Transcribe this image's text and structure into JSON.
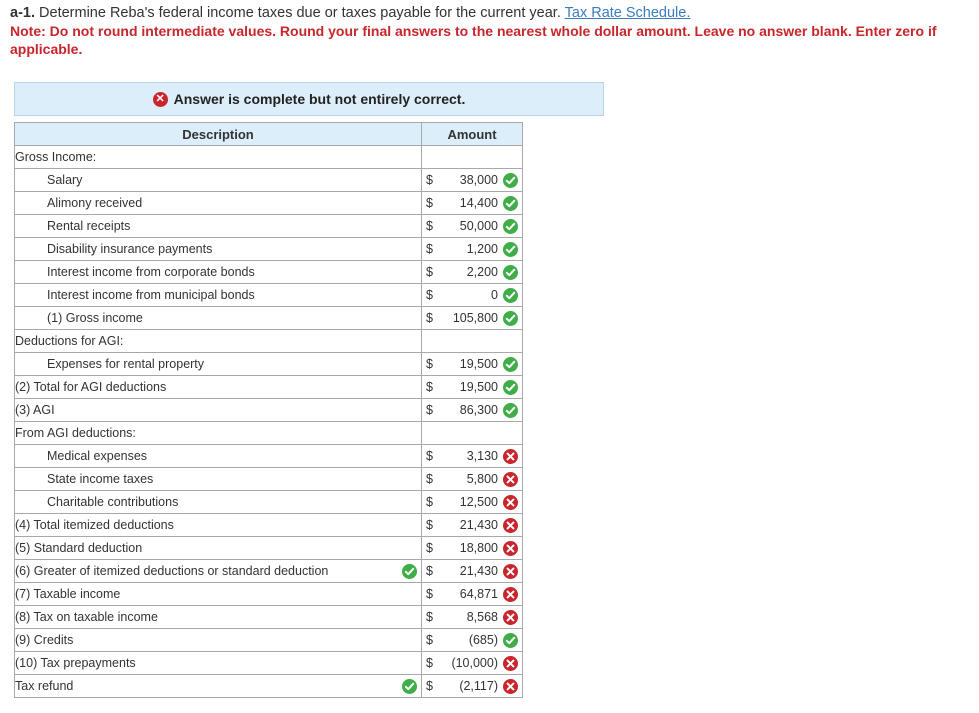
{
  "header": {
    "part": "a-1.",
    "question": " Determine Reba's federal income taxes due or taxes payable for the current year. ",
    "link": "Tax Rate Schedule.",
    "note": "Note: Do not round intermediate values. Round your final answers to the nearest whole dollar amount. Leave no answer blank. Enter zero if applicable."
  },
  "banner": {
    "text": "Answer is complete but not entirely correct."
  },
  "table": {
    "col_description": "Description",
    "col_amount": "Amount",
    "rows": [
      {
        "label": "Gross Income:",
        "indent": 0
      },
      {
        "label": "Salary",
        "indent": 1,
        "currency": "$",
        "amount": "38,000",
        "status": "correct"
      },
      {
        "label": "Alimony received",
        "indent": 1,
        "currency": "$",
        "amount": "14,400",
        "status": "correct"
      },
      {
        "label": "Rental receipts",
        "indent": 1,
        "currency": "$",
        "amount": "50,000",
        "status": "correct"
      },
      {
        "label": "Disability insurance payments",
        "indent": 1,
        "currency": "$",
        "amount": "1,200",
        "status": "correct"
      },
      {
        "label": "Interest income from corporate bonds",
        "indent": 1,
        "currency": "$",
        "amount": "2,200",
        "status": "correct"
      },
      {
        "label": "Interest income from municipal bonds",
        "indent": 1,
        "currency": "$",
        "amount": "0",
        "status": "correct"
      },
      {
        "label": "(1) Gross income",
        "indent": 1,
        "currency": "$",
        "amount": "105,800",
        "status": "correct"
      },
      {
        "label": "Deductions for AGI:",
        "indent": 0
      },
      {
        "label": "Expenses for rental property",
        "indent": 1,
        "currency": "$",
        "amount": "19,500",
        "status": "correct"
      },
      {
        "label": "(2) Total for AGI deductions",
        "indent": 0,
        "currency": "$",
        "amount": "19,500",
        "status": "correct"
      },
      {
        "label": "(3) AGI",
        "indent": 0,
        "currency": "$",
        "amount": "86,300",
        "status": "correct"
      },
      {
        "label": "From AGI deductions:",
        "indent": 0
      },
      {
        "label": "Medical expenses",
        "indent": 1,
        "currency": "$",
        "amount": "3,130",
        "status": "incorrect"
      },
      {
        "label": "State income taxes",
        "indent": 1,
        "currency": "$",
        "amount": "5,800",
        "status": "incorrect"
      },
      {
        "label": "Charitable contributions",
        "indent": 1,
        "currency": "$",
        "amount": "12,500",
        "status": "incorrect"
      },
      {
        "label": "(4) Total itemized deductions",
        "indent": 0,
        "currency": "$",
        "amount": "21,430",
        "status": "incorrect"
      },
      {
        "label": "(5) Standard deduction",
        "indent": 0,
        "currency": "$",
        "amount": "18,800",
        "status": "incorrect"
      },
      {
        "label": "(6) Greater of itemized deductions or standard deduction",
        "indent": 0,
        "label_status": "correct",
        "currency": "$",
        "amount": "21,430",
        "status": "incorrect"
      },
      {
        "label": "(7) Taxable income",
        "indent": 0,
        "currency": "$",
        "amount": "64,871",
        "status": "incorrect"
      },
      {
        "label": "(8) Tax on taxable income",
        "indent": 0,
        "currency": "$",
        "amount": "8,568",
        "status": "incorrect"
      },
      {
        "label": "(9) Credits",
        "indent": 0,
        "currency": "$",
        "amount": "(685)",
        "status": "correct"
      },
      {
        "label": "(10) Tax prepayments",
        "indent": 0,
        "currency": "$",
        "amount": "(10,000)",
        "status": "incorrect"
      },
      {
        "label": "Tax refund",
        "indent": 0,
        "label_status": "correct",
        "currency": "$",
        "amount": "(2,117)",
        "status": "incorrect"
      }
    ]
  },
  "colors": {
    "correct": "#3fae49",
    "incorrect": "#c8252c",
    "header_bg": "#dceefa",
    "link": "#3b7bbf"
  }
}
